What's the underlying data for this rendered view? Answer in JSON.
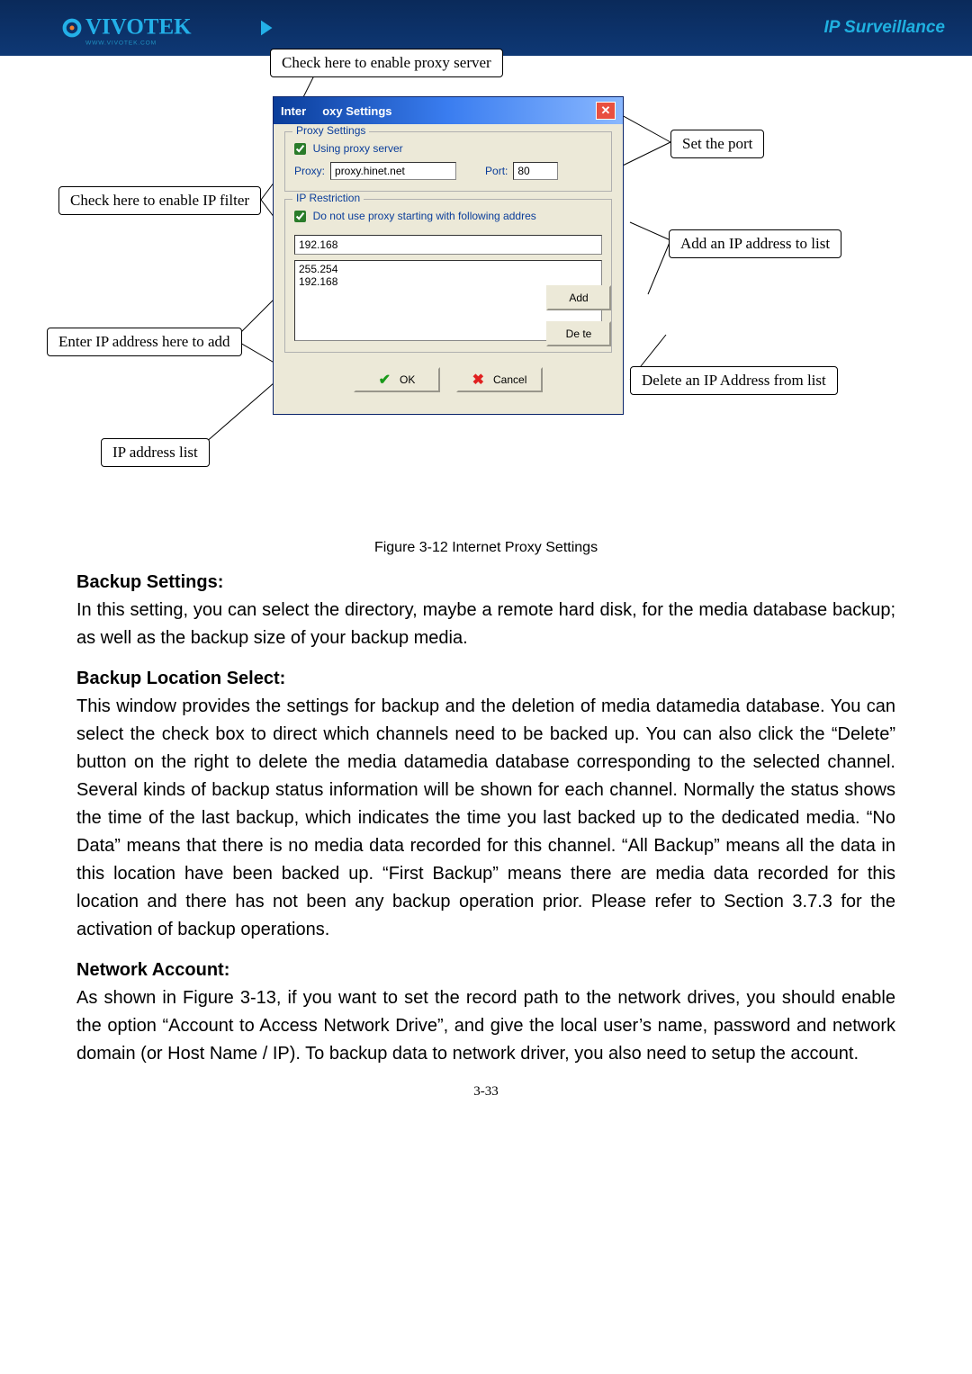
{
  "header": {
    "ip_surv": "IP Surveillance",
    "logo_url": "WWW.VIVOTEK.COM"
  },
  "callouts": {
    "check_proxy": "Check here to enable proxy server",
    "set_port": "Set the port",
    "ip_filter": "Check here to enable IP filter",
    "add_ip_list": "Add an IP address to list",
    "enter_ip": "Enter IP address here to add",
    "del_ip": "Delete an IP Address from list",
    "ip_addr_list": "IP address list"
  },
  "dialog": {
    "title_left": "Inter",
    "title_right": "oxy Settings",
    "group1_legend": "Proxy Settings",
    "chk_proxy": "Using proxy server",
    "proxy_label": "Proxy:",
    "proxy_value": "proxy.hinet.net",
    "port_label": "Port:",
    "port_value": "80",
    "group2_legend": "IP Restriction",
    "chk_iprestrict": "Do not use proxy starting with following addres",
    "ip_new": "192.168",
    "ip_list": [
      "255.254",
      "192.168"
    ],
    "btn_add": "Add",
    "btn_delete": "De   te",
    "btn_ok": "OK",
    "btn_cancel": "Cancel"
  },
  "caption": "Figure 3-12 Internet Proxy Settings",
  "sections": {
    "s1h": "Backup Settings:",
    "s1p": "In this setting, you can select the directory, maybe a remote hard disk, for the media database backup; as well as the backup size of your backup media.",
    "s2h": "Backup Location Select:",
    "s2p": "This window provides the settings for backup and the deletion of media datamedia database. You can select the check box to direct which channels need to be backed up. You can also click the “Delete” button on the right to delete the media datamedia database corresponding to the selected channel. Several kinds of backup status information will be shown for each channel. Normally the status shows the time of the last backup, which indicates the time you last backed up to the dedicated media. “No Data” means that there is no media data recorded for this channel. “All Backup” means all the data in this location have been backed up. “First Backup” means there are media data recorded for this location and there has not been any backup operation prior. Please refer to Section 3.7.3 for the activation of backup operations.",
    "s3h": "Network Account:",
    "s3p": "As shown in Figure 3-13, if you want to set the record path to the network drives, you should enable the option “Account to Access Network Drive”, and give the local user’s name, password and network domain (or Host Name / IP). To backup data to network driver, you also need to setup the account."
  },
  "pagenum": "3-33"
}
